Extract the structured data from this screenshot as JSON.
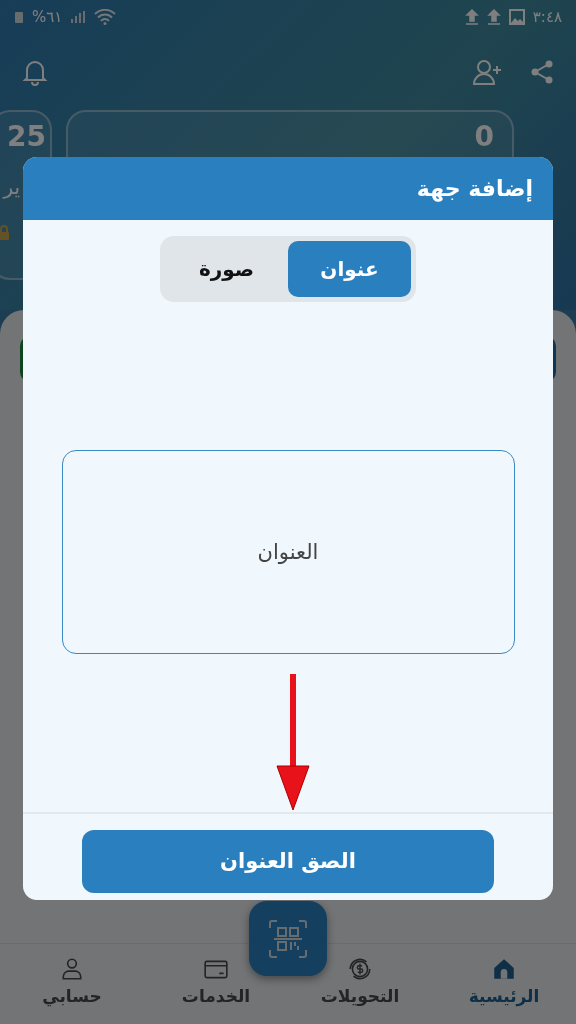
{
  "status_bar": {
    "time": "٣:٤٨",
    "battery": "%٦١"
  },
  "cards": [
    {
      "value": "0"
    },
    {
      "value": "25",
      "label": "ير"
    }
  ],
  "dialog": {
    "title": "إضافة جهة",
    "tabs": [
      {
        "label": "عنوان",
        "selected": true
      },
      {
        "label": "صورة",
        "selected": false
      }
    ],
    "address_field": {
      "placeholder": "العنوان"
    },
    "paste_button": "الصق العنوان"
  },
  "bottom_nav": [
    {
      "label": "الرئيسية",
      "kind": "home",
      "selected": true
    },
    {
      "label": "التحويلات",
      "kind": "transfers",
      "selected": false
    },
    {
      "label": "الخدمات",
      "kind": "card",
      "selected": false
    },
    {
      "label": "حسابي",
      "kind": "account",
      "selected": false
    }
  ]
}
